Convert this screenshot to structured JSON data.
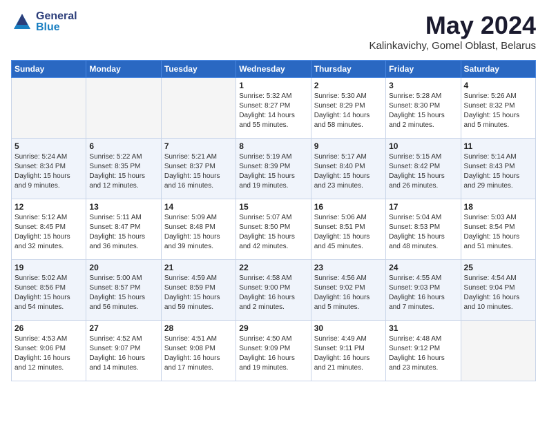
{
  "header": {
    "logo_general": "General",
    "logo_blue": "Blue",
    "month": "May 2024",
    "location": "Kalinkavichy, Gomel Oblast, Belarus"
  },
  "weekdays": [
    "Sunday",
    "Monday",
    "Tuesday",
    "Wednesday",
    "Thursday",
    "Friday",
    "Saturday"
  ],
  "weeks": [
    [
      {
        "day": "",
        "sunrise": "",
        "sunset": "",
        "daylight": ""
      },
      {
        "day": "",
        "sunrise": "",
        "sunset": "",
        "daylight": ""
      },
      {
        "day": "",
        "sunrise": "",
        "sunset": "",
        "daylight": ""
      },
      {
        "day": "1",
        "sunrise": "Sunrise: 5:32 AM",
        "sunset": "Sunset: 8:27 PM",
        "daylight": "Daylight: 14 hours and 55 minutes."
      },
      {
        "day": "2",
        "sunrise": "Sunrise: 5:30 AM",
        "sunset": "Sunset: 8:29 PM",
        "daylight": "Daylight: 14 hours and 58 minutes."
      },
      {
        "day": "3",
        "sunrise": "Sunrise: 5:28 AM",
        "sunset": "Sunset: 8:30 PM",
        "daylight": "Daylight: 15 hours and 2 minutes."
      },
      {
        "day": "4",
        "sunrise": "Sunrise: 5:26 AM",
        "sunset": "Sunset: 8:32 PM",
        "daylight": "Daylight: 15 hours and 5 minutes."
      }
    ],
    [
      {
        "day": "5",
        "sunrise": "Sunrise: 5:24 AM",
        "sunset": "Sunset: 8:34 PM",
        "daylight": "Daylight: 15 hours and 9 minutes."
      },
      {
        "day": "6",
        "sunrise": "Sunrise: 5:22 AM",
        "sunset": "Sunset: 8:35 PM",
        "daylight": "Daylight: 15 hours and 12 minutes."
      },
      {
        "day": "7",
        "sunrise": "Sunrise: 5:21 AM",
        "sunset": "Sunset: 8:37 PM",
        "daylight": "Daylight: 15 hours and 16 minutes."
      },
      {
        "day": "8",
        "sunrise": "Sunrise: 5:19 AM",
        "sunset": "Sunset: 8:39 PM",
        "daylight": "Daylight: 15 hours and 19 minutes."
      },
      {
        "day": "9",
        "sunrise": "Sunrise: 5:17 AM",
        "sunset": "Sunset: 8:40 PM",
        "daylight": "Daylight: 15 hours and 23 minutes."
      },
      {
        "day": "10",
        "sunrise": "Sunrise: 5:15 AM",
        "sunset": "Sunset: 8:42 PM",
        "daylight": "Daylight: 15 hours and 26 minutes."
      },
      {
        "day": "11",
        "sunrise": "Sunrise: 5:14 AM",
        "sunset": "Sunset: 8:43 PM",
        "daylight": "Daylight: 15 hours and 29 minutes."
      }
    ],
    [
      {
        "day": "12",
        "sunrise": "Sunrise: 5:12 AM",
        "sunset": "Sunset: 8:45 PM",
        "daylight": "Daylight: 15 hours and 32 minutes."
      },
      {
        "day": "13",
        "sunrise": "Sunrise: 5:11 AM",
        "sunset": "Sunset: 8:47 PM",
        "daylight": "Daylight: 15 hours and 36 minutes."
      },
      {
        "day": "14",
        "sunrise": "Sunrise: 5:09 AM",
        "sunset": "Sunset: 8:48 PM",
        "daylight": "Daylight: 15 hours and 39 minutes."
      },
      {
        "day": "15",
        "sunrise": "Sunrise: 5:07 AM",
        "sunset": "Sunset: 8:50 PM",
        "daylight": "Daylight: 15 hours and 42 minutes."
      },
      {
        "day": "16",
        "sunrise": "Sunrise: 5:06 AM",
        "sunset": "Sunset: 8:51 PM",
        "daylight": "Daylight: 15 hours and 45 minutes."
      },
      {
        "day": "17",
        "sunrise": "Sunrise: 5:04 AM",
        "sunset": "Sunset: 8:53 PM",
        "daylight": "Daylight: 15 hours and 48 minutes."
      },
      {
        "day": "18",
        "sunrise": "Sunrise: 5:03 AM",
        "sunset": "Sunset: 8:54 PM",
        "daylight": "Daylight: 15 hours and 51 minutes."
      }
    ],
    [
      {
        "day": "19",
        "sunrise": "Sunrise: 5:02 AM",
        "sunset": "Sunset: 8:56 PM",
        "daylight": "Daylight: 15 hours and 54 minutes."
      },
      {
        "day": "20",
        "sunrise": "Sunrise: 5:00 AM",
        "sunset": "Sunset: 8:57 PM",
        "daylight": "Daylight: 15 hours and 56 minutes."
      },
      {
        "day": "21",
        "sunrise": "Sunrise: 4:59 AM",
        "sunset": "Sunset: 8:59 PM",
        "daylight": "Daylight: 15 hours and 59 minutes."
      },
      {
        "day": "22",
        "sunrise": "Sunrise: 4:58 AM",
        "sunset": "Sunset: 9:00 PM",
        "daylight": "Daylight: 16 hours and 2 minutes."
      },
      {
        "day": "23",
        "sunrise": "Sunrise: 4:56 AM",
        "sunset": "Sunset: 9:02 PM",
        "daylight": "Daylight: 16 hours and 5 minutes."
      },
      {
        "day": "24",
        "sunrise": "Sunrise: 4:55 AM",
        "sunset": "Sunset: 9:03 PM",
        "daylight": "Daylight: 16 hours and 7 minutes."
      },
      {
        "day": "25",
        "sunrise": "Sunrise: 4:54 AM",
        "sunset": "Sunset: 9:04 PM",
        "daylight": "Daylight: 16 hours and 10 minutes."
      }
    ],
    [
      {
        "day": "26",
        "sunrise": "Sunrise: 4:53 AM",
        "sunset": "Sunset: 9:06 PM",
        "daylight": "Daylight: 16 hours and 12 minutes."
      },
      {
        "day": "27",
        "sunrise": "Sunrise: 4:52 AM",
        "sunset": "Sunset: 9:07 PM",
        "daylight": "Daylight: 16 hours and 14 minutes."
      },
      {
        "day": "28",
        "sunrise": "Sunrise: 4:51 AM",
        "sunset": "Sunset: 9:08 PM",
        "daylight": "Daylight: 16 hours and 17 minutes."
      },
      {
        "day": "29",
        "sunrise": "Sunrise: 4:50 AM",
        "sunset": "Sunset: 9:09 PM",
        "daylight": "Daylight: 16 hours and 19 minutes."
      },
      {
        "day": "30",
        "sunrise": "Sunrise: 4:49 AM",
        "sunset": "Sunset: 9:11 PM",
        "daylight": "Daylight: 16 hours and 21 minutes."
      },
      {
        "day": "31",
        "sunrise": "Sunrise: 4:48 AM",
        "sunset": "Sunset: 9:12 PM",
        "daylight": "Daylight: 16 hours and 23 minutes."
      },
      {
        "day": "",
        "sunrise": "",
        "sunset": "",
        "daylight": ""
      }
    ]
  ]
}
